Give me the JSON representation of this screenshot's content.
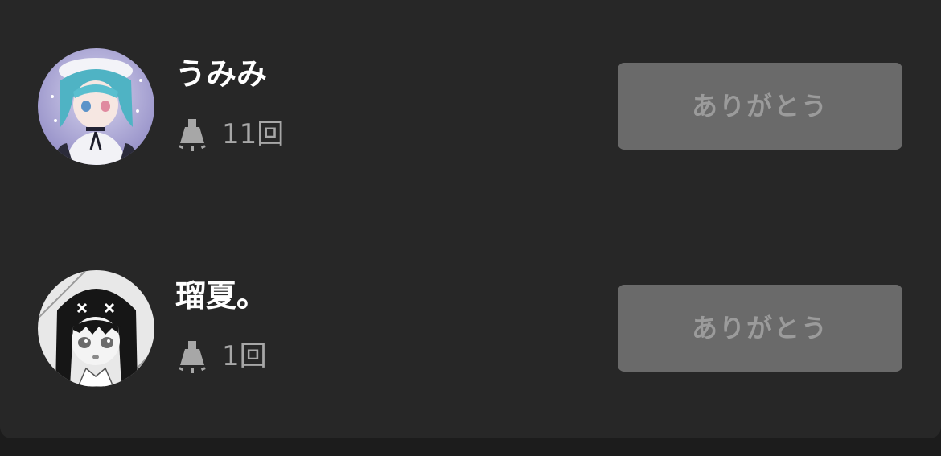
{
  "colors": {
    "background": "#272727",
    "name_text": "#ffffff",
    "count_text": "#a7a7a7",
    "button_bg": "#6a6a6a",
    "button_text": "#9b9b9b"
  },
  "users": [
    {
      "name": "うみみ",
      "count": "11回",
      "stat_icon": "lamp-icon",
      "avatar": "anime-avatar-blue-hair",
      "button_label": "ありがとう"
    },
    {
      "name": "瑠夏。",
      "count": "1回",
      "stat_icon": "lamp-icon",
      "avatar": "anime-avatar-monochrome",
      "button_label": "ありがとう"
    }
  ]
}
